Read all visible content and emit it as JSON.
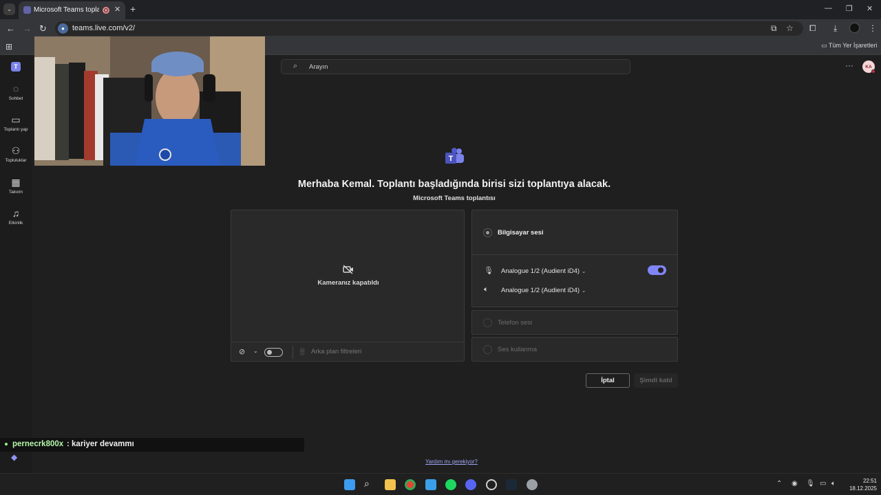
{
  "browser": {
    "tab_title": "Microsoft Teams toplantısı |",
    "url": "teams.live.com/v2/",
    "bookmarks_all": "Tüm Yer İşaretleri",
    "new_tab_glyph": "+",
    "tab_close_glyph": "✕"
  },
  "rail": {
    "items": [
      {
        "label": "Sohbet",
        "icon": "chat-icon"
      },
      {
        "label": "Toplantı yap",
        "icon": "video-camera-icon"
      },
      {
        "label": "Topluluklar",
        "icon": "communities-icon"
      },
      {
        "label": "Takvim",
        "icon": "calendar-icon"
      },
      {
        "label": "Etkinlik",
        "icon": "bell-icon"
      }
    ]
  },
  "header": {
    "search_placeholder": "Arayın",
    "avatar_initials": "KA"
  },
  "main": {
    "headline": "Merhaba Kemal. Toplantı başladığında birisi sizi toplantıya alacak.",
    "subhead": "Microsoft Teams toplantısı",
    "camera_off_text": "Kameranız kapatıldı",
    "background_filters": "Arka plan filtreleri",
    "computer_audio": "Bilgisayar sesi",
    "mic_device": "Analogue 1/2 (Audient iD4)",
    "speaker_device": "Analogue 1/2 (Audient iD4)",
    "phone_audio": "Telefon sesi",
    "no_audio": "Ses kullanma",
    "cancel_button": "İptal",
    "join_button": "Şimdi katıl",
    "help_link": "Yardım mı gerekiyor?"
  },
  "chat_overlay": {
    "user": "pernecrk800x",
    "message": ": kariyer devammı"
  },
  "taskbar": {
    "time": "22:51",
    "date": "18.12.2025"
  },
  "colors": {
    "accent": "#7f85f5",
    "teams_purple": "#6264a7",
    "chat_user": "#b6f7a9"
  }
}
